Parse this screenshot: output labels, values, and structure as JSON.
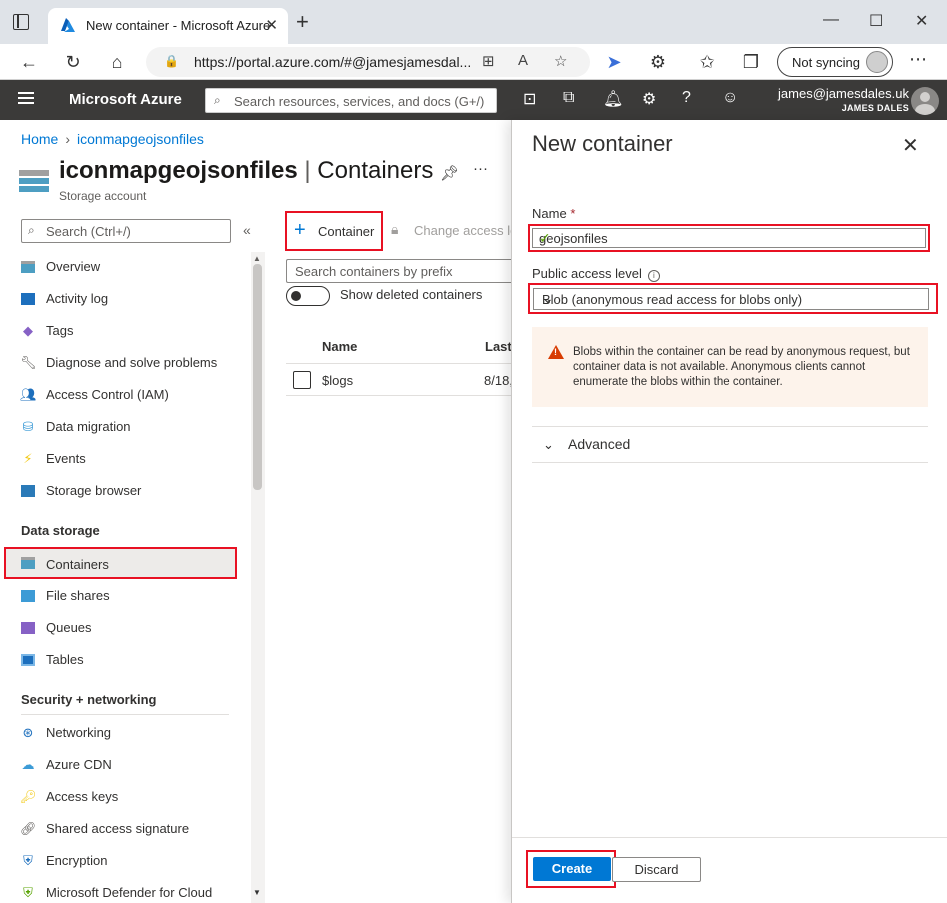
{
  "browser": {
    "tab_title": "New container - Microsoft Azure",
    "url": "https://portal.azure.com/#@jamesjamesdal...",
    "sync_label": "Not syncing"
  },
  "azure": {
    "brand": "Microsoft Azure",
    "search_placeholder": "Search resources, services, and docs (G+/)",
    "account_email": "james@jamesdales.uk",
    "account_name": "JAMES DALES"
  },
  "breadcrumb": [
    "Home",
    "iconmapgeojsonfiles"
  ],
  "header": {
    "resource_name": "iconmapgeojsonfiles",
    "section": "Containers",
    "subtitle": "Storage account"
  },
  "nav": {
    "search_placeholder": "Search (Ctrl+/)",
    "items": [
      "Overview",
      "Activity log",
      "Tags",
      "Diagnose and solve problems",
      "Access Control (IAM)",
      "Data migration",
      "Events",
      "Storage browser"
    ],
    "section_data_storage": "Data storage",
    "data_items": [
      "Containers",
      "File shares",
      "Queues",
      "Tables"
    ],
    "section_security": "Security + networking",
    "security_items": [
      "Networking",
      "Azure CDN",
      "Access keys",
      "Shared access signature",
      "Encryption",
      "Microsoft Defender for Cloud"
    ]
  },
  "main": {
    "add_container": "Container",
    "change_access": "Change access le",
    "search_placeholder": "Search containers by prefix",
    "toggle_label": "Show deleted containers",
    "col_name": "Name",
    "col_last": "Last",
    "rows": [
      {
        "name": "$logs",
        "date": "8/18,"
      }
    ]
  },
  "panel": {
    "title": "New container",
    "name_label": "Name",
    "name_required": "*",
    "name_value": "geojsonfiles",
    "access_label": "Public access level",
    "access_value": "Blob (anonymous read access for blobs only)",
    "warning": "Blobs within the container can be read by anonymous request, but container data is not available. Anonymous clients cannot enumerate the blobs within the container.",
    "advanced": "Advanced",
    "create": "Create",
    "discard": "Discard"
  },
  "colors": {
    "accent": "#0078d4",
    "highlight": "#e81123",
    "azure_bar": "#3b3a39"
  }
}
